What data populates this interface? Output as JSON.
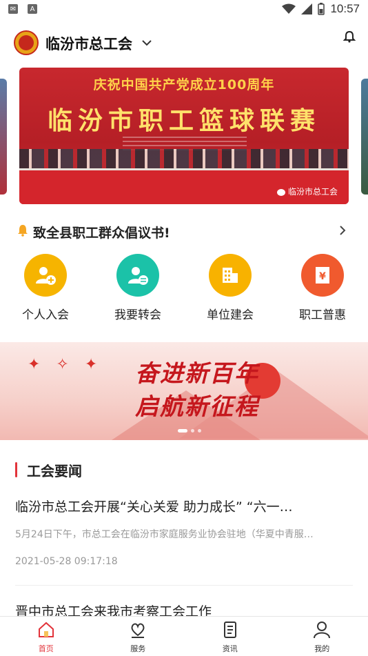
{
  "status_bar": {
    "time": "10:57"
  },
  "header": {
    "title": "临汾市总工会"
  },
  "banner": {
    "top_text": "庆祝中国共产党成立100周年",
    "main_text": "临汾市职工篮球联赛",
    "watermark": "临汾市总工会"
  },
  "notice": {
    "text": "致全县职工群众倡议书!"
  },
  "quick_actions": [
    {
      "label": "个人入会",
      "color": "#f6b400",
      "icon": "person-add-icon"
    },
    {
      "label": "我要转会",
      "color": "#1bc2a8",
      "icon": "person-transfer-icon"
    },
    {
      "label": "单位建会",
      "color": "#f8b200",
      "icon": "building-icon"
    },
    {
      "label": "职工普惠",
      "color": "#f05a2e",
      "icon": "voucher-icon"
    }
  ],
  "promo": {
    "line1": "奋进新百年",
    "line2": "启航新征程"
  },
  "news_section": {
    "title": "工会要闻",
    "items": [
      {
        "title": "临汾市总工会开展“关心关爱 助力成长” “六一…",
        "summary": "5月24日下午，市总工会在临汾市家庭服务业协会驻地（华夏中青服…",
        "date": "2021-05-28 09:17:18"
      },
      {
        "title": "晋中市总工会来我市考察工会工作"
      }
    ]
  },
  "tabbar": [
    {
      "label": "首页",
      "icon": "home-icon",
      "active": true
    },
    {
      "label": "服务",
      "icon": "service-heart-icon",
      "active": false
    },
    {
      "label": "资讯",
      "icon": "document-icon",
      "active": false
    },
    {
      "label": "我的",
      "icon": "user-icon",
      "active": false
    }
  ],
  "colors": {
    "accent": "#e2333a",
    "banner_red": "#c8282e"
  }
}
